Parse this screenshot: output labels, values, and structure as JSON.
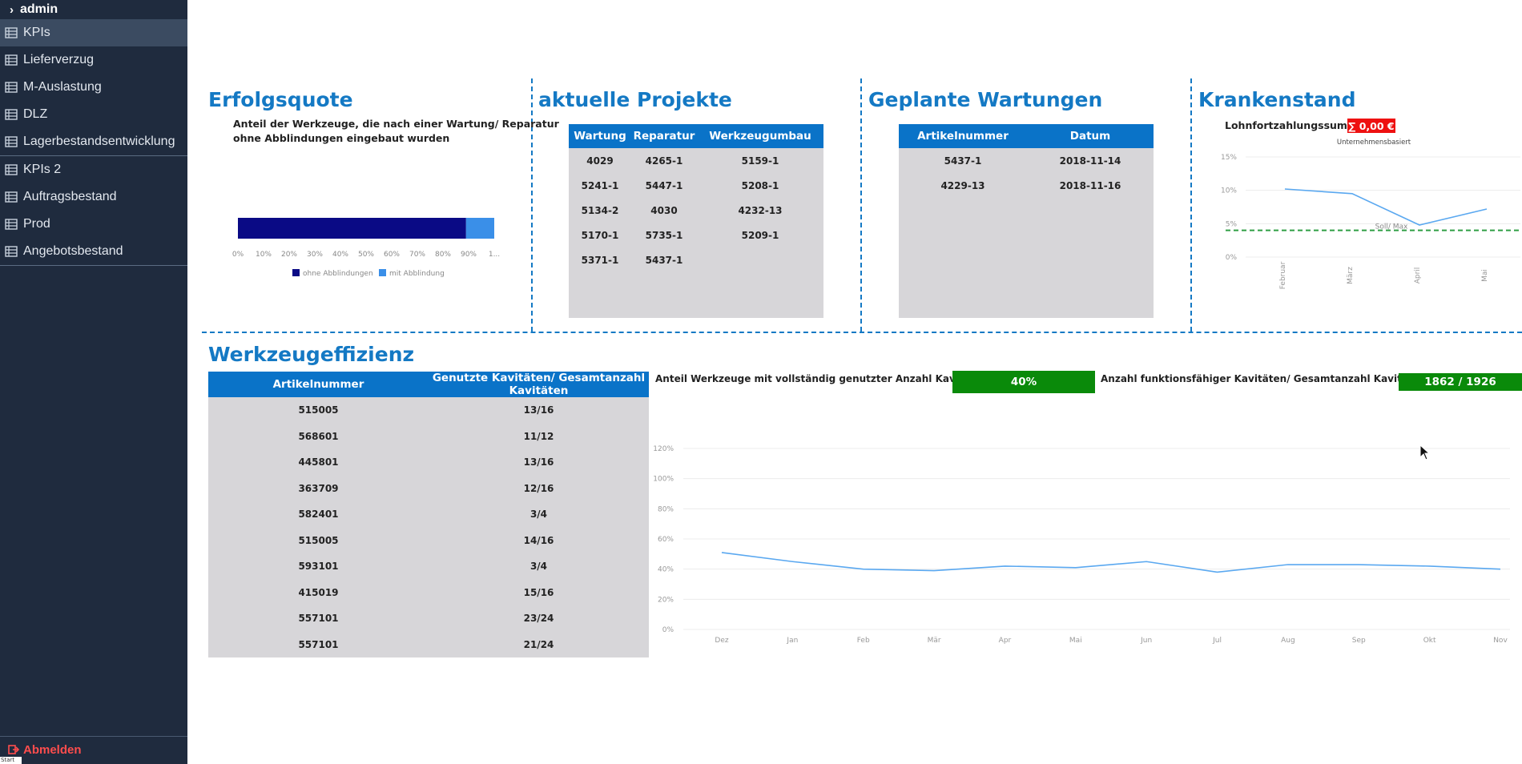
{
  "sidebar": {
    "user": "admin",
    "group1": [
      "KPIs",
      "Lieferverzug",
      "M-Auslastung",
      "DLZ",
      "Lagerbestandsentwicklung"
    ],
    "group2": [
      "KPIs 2",
      "Auftragsbestand",
      "Prod",
      "Angebotsbestand"
    ],
    "logout": "Abmelden",
    "corner": "Start"
  },
  "erfolgsquote": {
    "title": "Erfolgsquote",
    "subtitle_line1": "Anteil der Werkzeuge, die nach einer Wartung/ Reparatur",
    "subtitle_line2": "ohne Abblindungen eingebaut wurden",
    "chart_data": {
      "type": "bar",
      "orientation": "horizontal",
      "stacked": true,
      "series": [
        {
          "name": "ohne Abblindungen",
          "values": [
            89
          ],
          "color": "#0a0a85"
        },
        {
          "name": "mit Abblindung",
          "values": [
            11
          ],
          "color": "#3a8fe8"
        }
      ],
      "ticks": [
        "0%",
        "10%",
        "20%",
        "30%",
        "40%",
        "50%",
        "60%",
        "70%",
        "80%",
        "90%",
        "1..."
      ],
      "xlim": [
        0,
        100
      ],
      "legend": "bottom"
    }
  },
  "projekte": {
    "title": "aktuelle Projekte",
    "headers": [
      "Wartung",
      "Reparatur",
      "Werkzeugumbau"
    ],
    "rows": [
      [
        "4029",
        "4265-1",
        "5159-1"
      ],
      [
        "5241-1",
        "5447-1",
        "5208-1"
      ],
      [
        "5134-2",
        "4030",
        "4232-13"
      ],
      [
        "5170-1",
        "5735-1",
        "5209-1"
      ],
      [
        "5371-1",
        "5437-1",
        ""
      ]
    ]
  },
  "wartungen": {
    "title": "Geplante Wartungen",
    "headers": [
      "Artikelnummer",
      "Datum"
    ],
    "rows": [
      [
        "5437-1",
        "2018-11-14"
      ],
      [
        "4229-13",
        "2018-11-16"
      ]
    ]
  },
  "krankenstand": {
    "title": "Krankenstand",
    "label": "Lohnfortzahlungssumme",
    "badge": "∑ 0,00 €",
    "badge_color": "#ee1111",
    "chart_data": {
      "type": "line",
      "subtitle": "Unternehmensbasiert",
      "categories": [
        "Februar",
        "März",
        "April",
        "Mai"
      ],
      "series": [
        {
          "values": [
            10.2,
            9.5,
            4.8,
            7.2
          ],
          "color": "#5aa8f0"
        }
      ],
      "reference_line": {
        "label": "Soll/ Max",
        "value": 4,
        "color": "#2f9e44"
      },
      "y_ticks": [
        "0%",
        "5%",
        "10%",
        "15%"
      ],
      "ylim": [
        0,
        15
      ]
    }
  },
  "effizienz": {
    "title": "Werkzeugeffizienz",
    "headers": [
      "Artikelnummer",
      "Genutzte Kavitäten/ Gesamtanzahl Kavitäten"
    ],
    "rows": [
      [
        "515005",
        "13/16"
      ],
      [
        "568601",
        "11/12"
      ],
      [
        "445801",
        "13/16"
      ],
      [
        "363709",
        "12/16"
      ],
      [
        "582401",
        "3/4"
      ],
      [
        "515005",
        "14/16"
      ],
      [
        "593101",
        "3/4"
      ],
      [
        "415019",
        "15/16"
      ],
      [
        "557101",
        "23/24"
      ],
      [
        "557101",
        "21/24"
      ]
    ],
    "kpi1_label": "Anteil Werkzeuge mit vollständig genutzter Anzahl Kavitäten",
    "kpi1_value": "40%",
    "kpi2_label": "Anzahl funktionsfähiger Kavitäten/ Gesamtanzahl Kavitäten",
    "kpi2_value": "1862 / 1926",
    "kpi_color": "#0a8a0a",
    "chart_data": {
      "type": "line",
      "categories": [
        "Dez",
        "Jan",
        "Feb",
        "Mär",
        "Apr",
        "Mai",
        "Jun",
        "Jul",
        "Aug",
        "Sep",
        "Okt",
        "Nov"
      ],
      "series": [
        {
          "values": [
            51,
            45,
            40,
            39,
            42,
            41,
            45,
            38,
            43,
            43,
            42,
            40
          ],
          "color": "#5aa8f0"
        }
      ],
      "y_ticks": [
        "0%",
        "20%",
        "40%",
        "60%",
        "80%",
        "100%",
        "120%"
      ],
      "ylim": [
        0,
        120
      ]
    }
  }
}
